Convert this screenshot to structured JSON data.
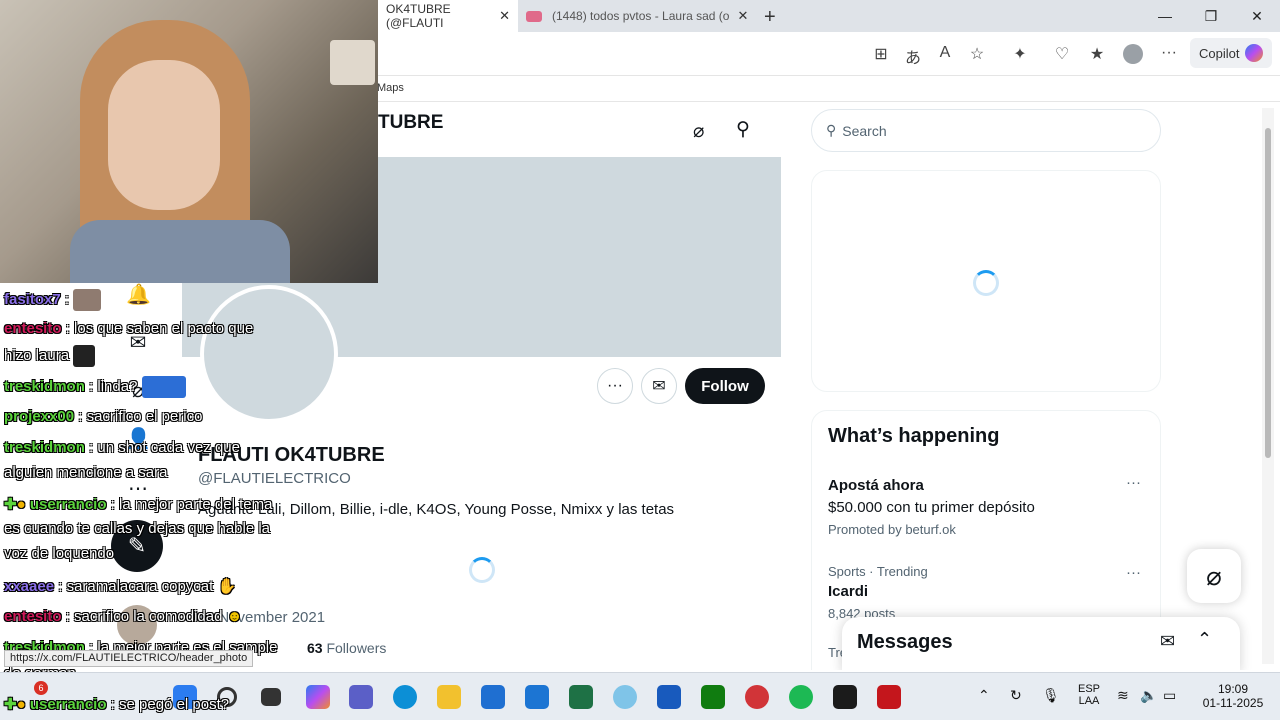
{
  "browser": {
    "tabs": [
      {
        "label": "OK4TUBRE (@FLAUTI",
        "active": true
      },
      {
        "label": "(1448) todos pvtos - Laura sad (o",
        "active": false
      }
    ],
    "new_tab": "+",
    "copilot": "Copilot",
    "favorite": "Maps"
  },
  "twitter": {
    "header_name": "TUBRE",
    "follow_label": "Follow",
    "more_label": "···",
    "display_name": "FLAUTI OK4TUBRE",
    "handle": "@FLAUTIELECTRICO",
    "bio": "Aguante Lali, Dillom, Billie, i-dle, K4OS, Young Posse, Nmixx y las tetas",
    "joined": "November 2021",
    "followers_count": "63",
    "followers_label": "Followers",
    "search_placeholder": "Search",
    "whats_happening": "What’s happening",
    "trends": [
      {
        "line1": "Apostá ahora",
        "line2": "$50.000 con tu primer depósito",
        "line3": "Promoted by beturf.ok"
      },
      {
        "line1": "Sports · Trending",
        "line2": "Icardi",
        "line3": "8,842 posts"
      }
    ],
    "trends_cut": "Tre",
    "messages_title": "Messages"
  },
  "status_url": "https://x.com/FLAUTIELECTRICO/header_photo",
  "chat": [
    {
      "user": "fasitox7",
      "color": "#8a6fe8",
      "text": ""
    },
    {
      "user": "entesito",
      "color": "#d01a5a",
      "text": "los que saben el pacto que"
    },
    {
      "user": "",
      "color": "#ffffff",
      "text": "hizo laura"
    },
    {
      "user": "treskidmon",
      "color": "#5bd43c",
      "text": "linda?"
    },
    {
      "user": "projexx00",
      "color": "#5bd43c",
      "text": "sacrifico el perico"
    },
    {
      "user": "treskidmon",
      "color": "#5bd43c",
      "text": "un shot cada vez que"
    },
    {
      "user": "",
      "color": "#ffffff",
      "text": "alguien mencione a sara"
    },
    {
      "user": "userrancio",
      "color": "#5bd43c",
      "text": "la mejor parte del tema"
    },
    {
      "user": "",
      "color": "#ffffff",
      "text": "es cuando te callas y dejas que hable la"
    },
    {
      "user": "",
      "color": "#ffffff",
      "text": "voz de loquendo"
    },
    {
      "user": "xxaaee",
      "color": "#8a6fe8",
      "text": "saramalacara copycat"
    },
    {
      "user": "entesito",
      "color": "#d01a5a",
      "text": "sacrifico la comodidad"
    },
    {
      "user": "treskidmon",
      "color": "#5bd43c",
      "text": "la mejor parte es el sample"
    },
    {
      "user": "",
      "color": "#ffffff",
      "text": "de german"
    },
    {
      "user": "userrancio",
      "color": "#5bd43c",
      "text": "se pegó el post?"
    }
  ],
  "taskbar": {
    "badge": "6",
    "lang_line1": "ESP",
    "lang_line2": "LAA",
    "time": "19:09",
    "date": "01-11-2025"
  }
}
